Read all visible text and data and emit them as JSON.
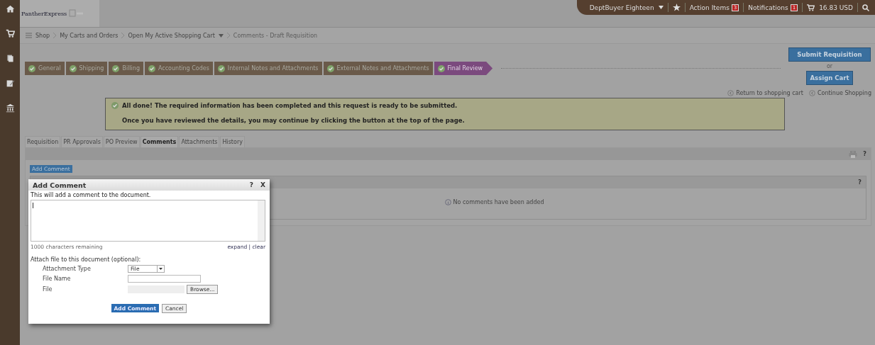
{
  "header": {
    "logo": "PantherExpress",
    "user": "DeptBuyer Eighteen",
    "action_items": {
      "label": "Action Items",
      "count": "3"
    },
    "notifications": {
      "label": "Notifications",
      "count": "1"
    },
    "cart_total": "16.83 USD"
  },
  "breadcrumb": [
    {
      "label": "Shop",
      "kind": "home"
    },
    {
      "label": "My Carts and Orders",
      "kind": "link"
    },
    {
      "label": "Open My Active Shopping Cart",
      "kind": "menu"
    },
    {
      "label": "Comments - Draft Requisition",
      "kind": "current"
    }
  ],
  "steps": [
    {
      "label": "General",
      "selected": false
    },
    {
      "label": "Shipping",
      "selected": false
    },
    {
      "label": "Billing",
      "selected": false
    },
    {
      "label": "Accounting Codes",
      "selected": false
    },
    {
      "label": "Internal Notes and Attachments",
      "selected": false
    },
    {
      "label": "External Notes and Attachments",
      "selected": false
    },
    {
      "label": "Final Review",
      "selected": true
    }
  ],
  "actions": {
    "submit": "Submit Requisition",
    "or": "or",
    "assign": "Assign Cart",
    "links": [
      "Return to shopping cart",
      "Continue Shopping"
    ]
  },
  "alert": {
    "title": "All done! The required information has been completed and this request is ready to be submitted.",
    "detail": "Once you have reviewed the details, you may continue by clicking the button at the top of the page."
  },
  "tabs": [
    {
      "label": "Requisition",
      "selected": false
    },
    {
      "label": "PR Approvals",
      "selected": false
    },
    {
      "label": "PO Preview",
      "selected": false
    },
    {
      "label": "Comments",
      "selected": true
    },
    {
      "label": "Attachments",
      "selected": false
    },
    {
      "label": "History",
      "selected": false
    }
  ],
  "panel": {
    "help": "?",
    "add_comment": "Add Comment",
    "list_help": "?",
    "empty_message": "No comments have been added"
  },
  "dialog": {
    "title": "Add Comment",
    "help": "?",
    "close": "X",
    "intro": "This will add a comment to the document.",
    "remaining": "1000 characters remaining",
    "expand": "expand",
    "separator": "|",
    "clear": "clear",
    "attach_heading": "Attach file to this document (optional):",
    "fields": [
      {
        "label": "Attachment Type",
        "kind": "select",
        "value": "File"
      },
      {
        "label": "File Name",
        "kind": "text"
      },
      {
        "label": "File",
        "kind": "file",
        "button": "Browse..."
      }
    ],
    "submit": "Add Comment",
    "cancel": "Cancel"
  }
}
